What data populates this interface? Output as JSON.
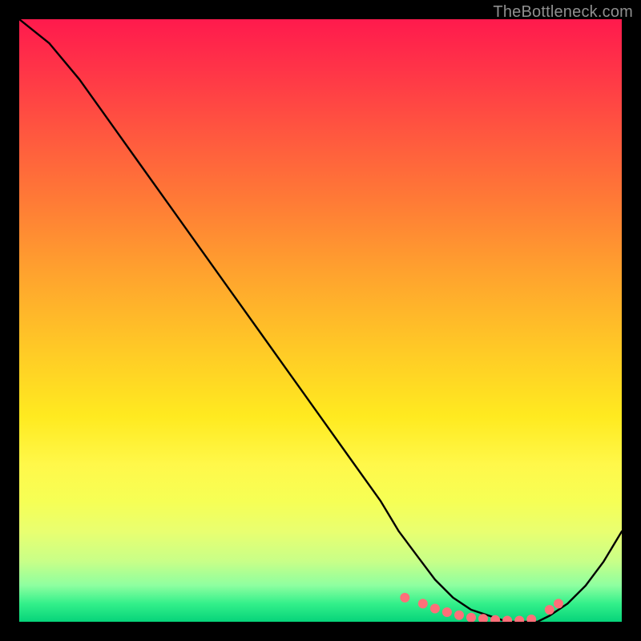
{
  "attribution": "TheBottleneck.com",
  "colors": {
    "curve": "#000000",
    "dots": "#ff6f79",
    "background": "#000000"
  },
  "chart_data": {
    "type": "line",
    "title": "",
    "xlabel": "",
    "ylabel": "",
    "xlim": [
      0,
      100
    ],
    "ylim": [
      0,
      100
    ],
    "grid": false,
    "legend": false,
    "annotations": [],
    "series": [
      {
        "name": "curve",
        "x": [
          0,
          5,
          10,
          15,
          20,
          25,
          30,
          35,
          40,
          45,
          50,
          55,
          60,
          63,
          66,
          69,
          72,
          75,
          78,
          81,
          84,
          86,
          88,
          91,
          94,
          97,
          100
        ],
        "y": [
          100,
          96,
          90,
          83,
          76,
          69,
          62,
          55,
          48,
          41,
          34,
          27,
          20,
          15,
          11,
          7,
          4,
          2,
          1,
          0,
          0,
          0,
          1,
          3,
          6,
          10,
          15
        ]
      }
    ],
    "highlight_dots": {
      "name": "dots",
      "x": [
        64,
        67,
        69,
        71,
        73,
        75,
        77,
        79,
        81,
        83,
        85,
        88,
        89.5
      ],
      "y": [
        4,
        3,
        2.2,
        1.6,
        1.1,
        0.7,
        0.5,
        0.3,
        0.2,
        0.2,
        0.4,
        2,
        3
      ]
    }
  }
}
